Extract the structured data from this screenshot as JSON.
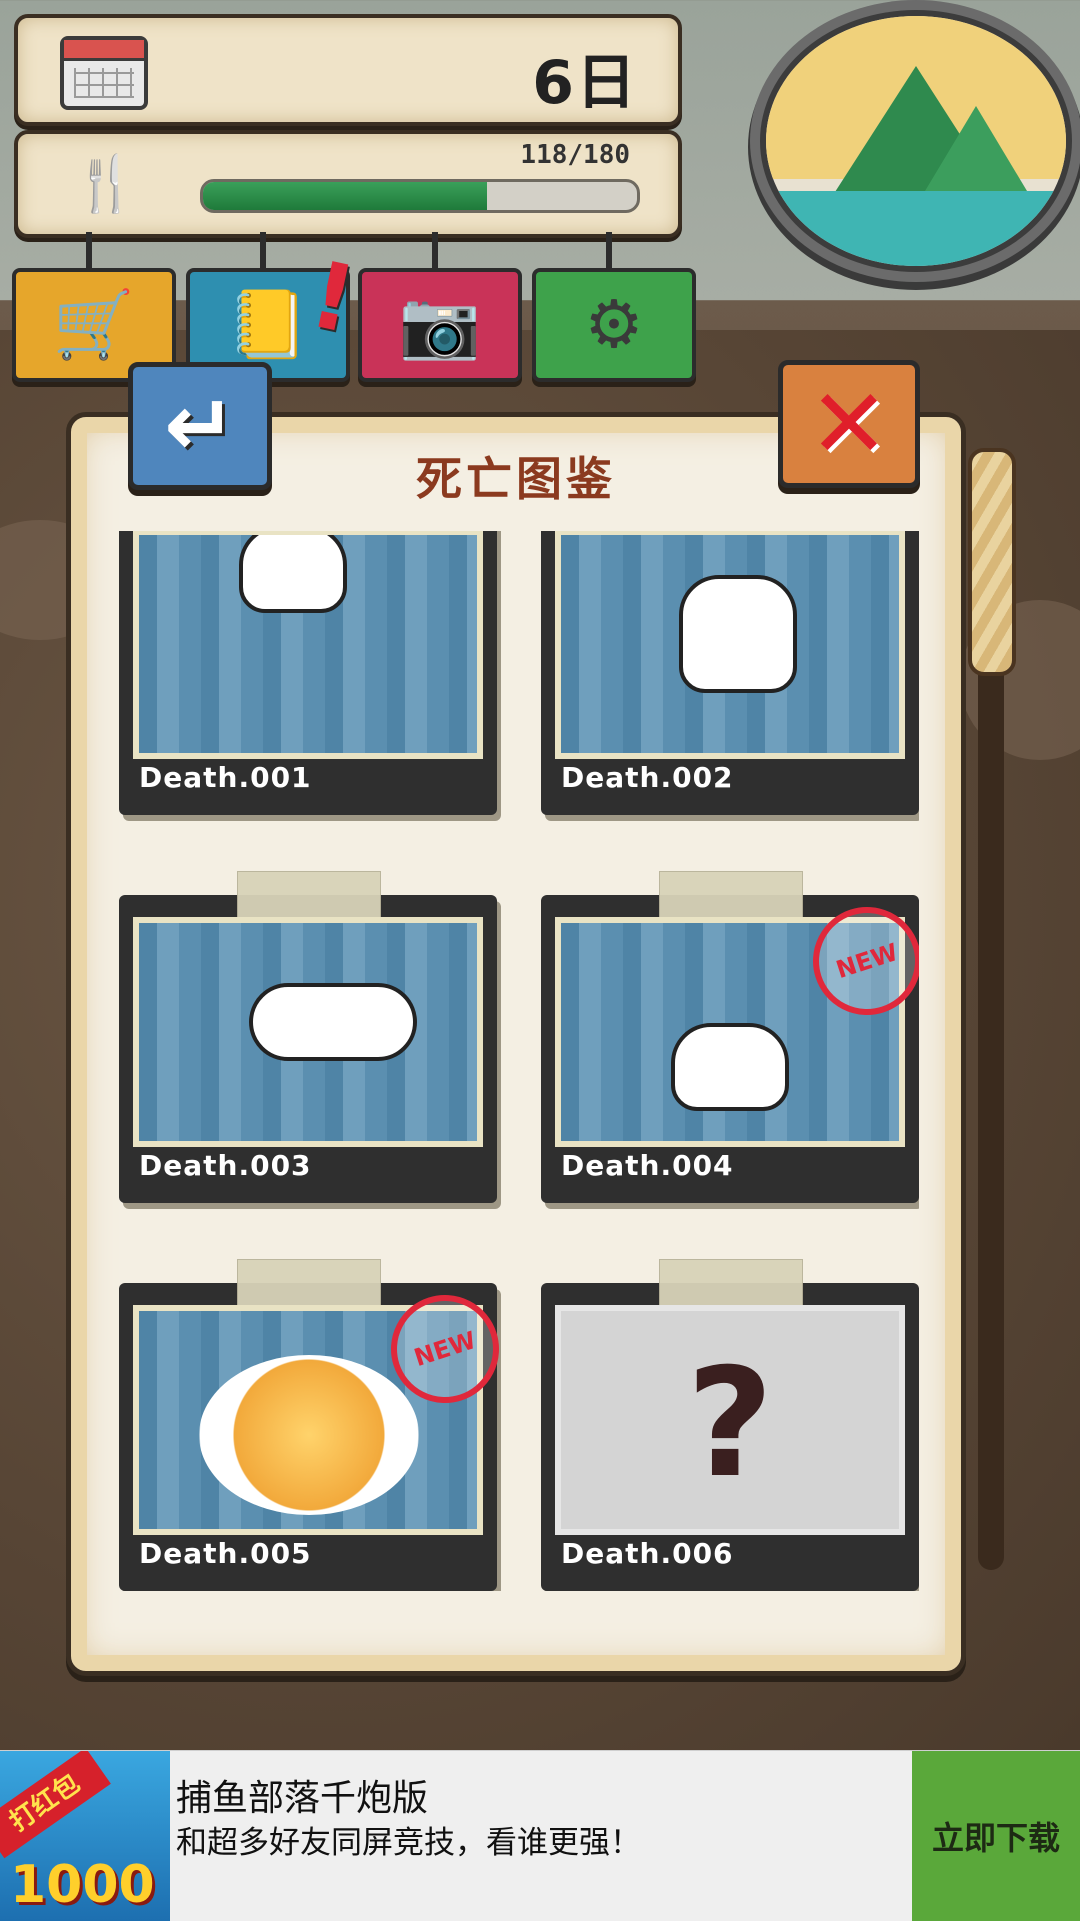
{
  "hud": {
    "day": "6日",
    "food": {
      "label": "118/180",
      "current": 118,
      "max": 180,
      "fill_fraction": 0.655
    }
  },
  "menu_icons": [
    "cart-icon",
    "notebook-icon",
    "camera-icon",
    "gear-icon"
  ],
  "dialog": {
    "title": "死亡图鉴",
    "cards": [
      {
        "caption": "Death.001",
        "unlocked": true,
        "is_new": false
      },
      {
        "caption": "Death.002",
        "unlocked": true,
        "is_new": false
      },
      {
        "caption": "Death.003",
        "unlocked": true,
        "is_new": false
      },
      {
        "caption": "Death.004",
        "unlocked": true,
        "is_new": true,
        "badge": "NEW"
      },
      {
        "caption": "Death.005",
        "unlocked": true,
        "is_new": true,
        "badge": "NEW"
      },
      {
        "caption": "Death.006",
        "unlocked": false,
        "is_new": false,
        "placeholder": "?"
      }
    ]
  },
  "ad": {
    "icon_ribbon": "打红包",
    "icon_number": "1000",
    "title": "捕鱼部落千炮版",
    "subtitle": "和超多好友同屏竞技，看谁更强！",
    "cta": "立即下载"
  },
  "colors": {
    "accent_red": "#e0283b",
    "title_brown": "#8b3a1f",
    "progress_green": "#2a8f4a",
    "ad_green": "#5aa83a"
  }
}
